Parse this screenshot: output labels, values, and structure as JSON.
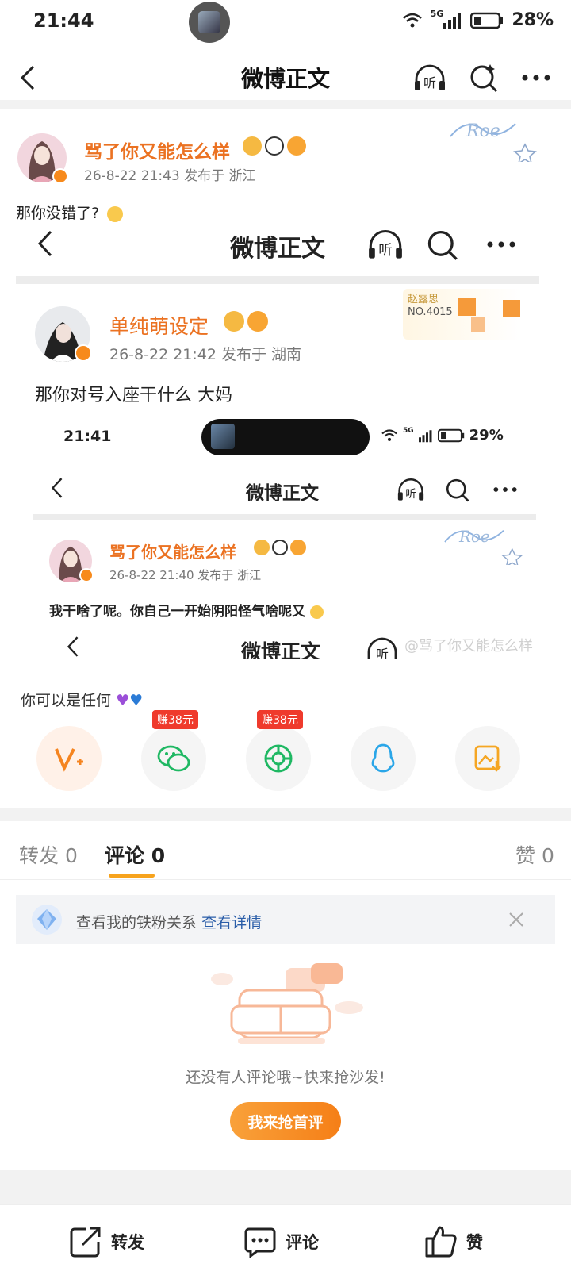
{
  "status_bar": {
    "time": "21:44",
    "network": "5G",
    "battery": "28%"
  },
  "nav": {
    "title": "微博正文",
    "listen_label": "听"
  },
  "post": {
    "username": "骂了你又能怎么样",
    "meta": "26-8-22 21:43  发布于 浙江",
    "text": "那你没错了?"
  },
  "embedded_1": {
    "nav_title": "微博正文",
    "listen_label": "听",
    "username": "单纯萌设定",
    "meta": "26-8-22 21:42  发布于 湖南",
    "text": "那你对号入座干什么 大妈",
    "sticker_name": "赵露思",
    "sticker_no": "NO.4015"
  },
  "embedded_2": {
    "time": "21:41",
    "network": "5G",
    "battery": "29%",
    "nav_title": "微博正文",
    "listen_label": "听",
    "username": "骂了你又能怎么样",
    "meta": "26-8-22 21:40  发布于 浙江",
    "text": "我干啥了呢。你自己一开始阴阳怪气啥呢又"
  },
  "embedded_3": {
    "nav_title": "微博正文",
    "listen_label": "听"
  },
  "watermark": "@骂了你又能怎么样",
  "share": {
    "tip": "你可以是任何",
    "earn_1": "赚38元",
    "earn_2": "赚38元"
  },
  "tabs": {
    "repost": "转发 0",
    "comment": "评论 0",
    "like": "赞 0"
  },
  "fan_card": {
    "text": "查看我的铁粉关系",
    "link": "查看详情"
  },
  "empty_state": {
    "text": "还没有人评论哦~快来抢沙发!",
    "button": "我来抢首评"
  },
  "bottom_bar": {
    "repost": "转发",
    "comment": "评论",
    "like": "赞"
  },
  "colors": {
    "accent_orange": "#eb7222",
    "vip_orange": "#f78a1c",
    "link_blue": "#2a5da8",
    "tab_underline": "#f7a31d"
  }
}
